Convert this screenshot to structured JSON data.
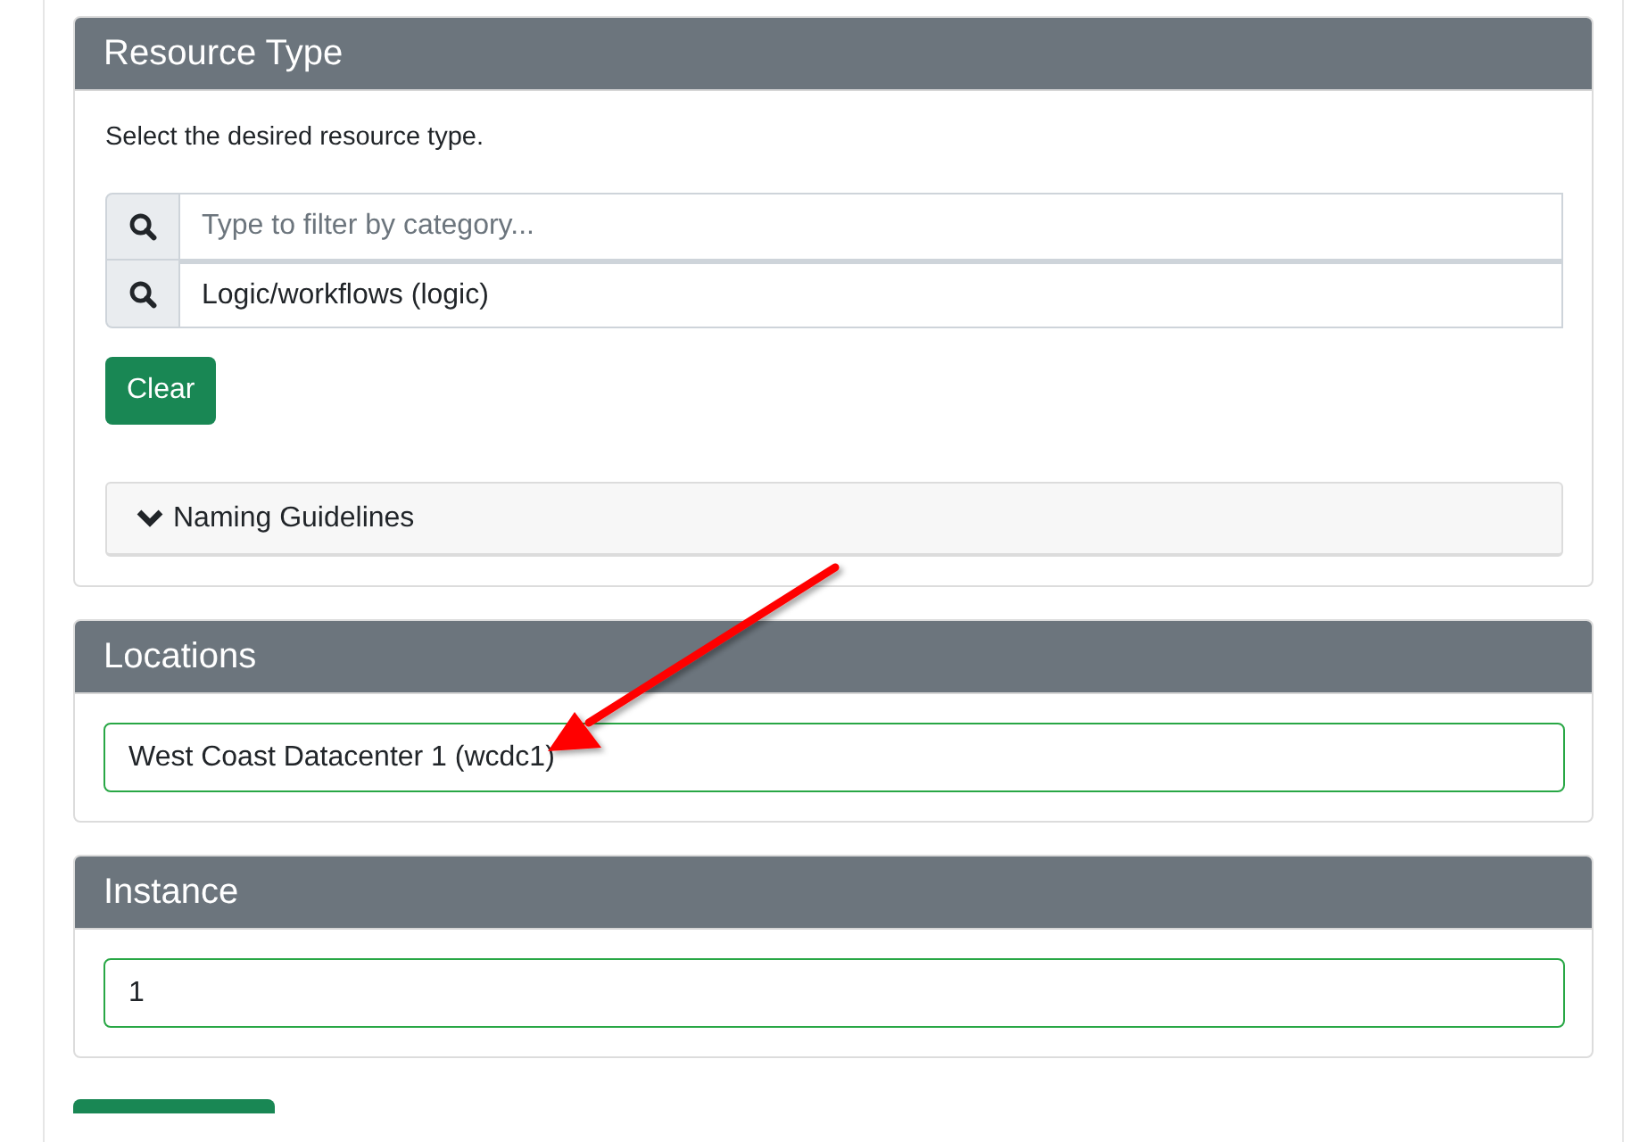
{
  "sections": [
    {
      "kind": "resource_type",
      "title": "Resource Type",
      "description": "Select the desired resource type.",
      "filter": {
        "placeholder": "Type to filter by category..."
      },
      "selection": {
        "value": "Logic/workflows (logic)"
      },
      "clear_button": "Clear",
      "guidelines": {
        "label": "Naming Guidelines",
        "expanded": false
      }
    },
    {
      "kind": "field",
      "title": "Locations",
      "field": {
        "value": "West Coast Datacenter 1 (wcdc1)",
        "valid": true
      }
    },
    {
      "kind": "field",
      "title": "Instance",
      "field": {
        "value": "1",
        "valid": true
      }
    }
  ]
}
